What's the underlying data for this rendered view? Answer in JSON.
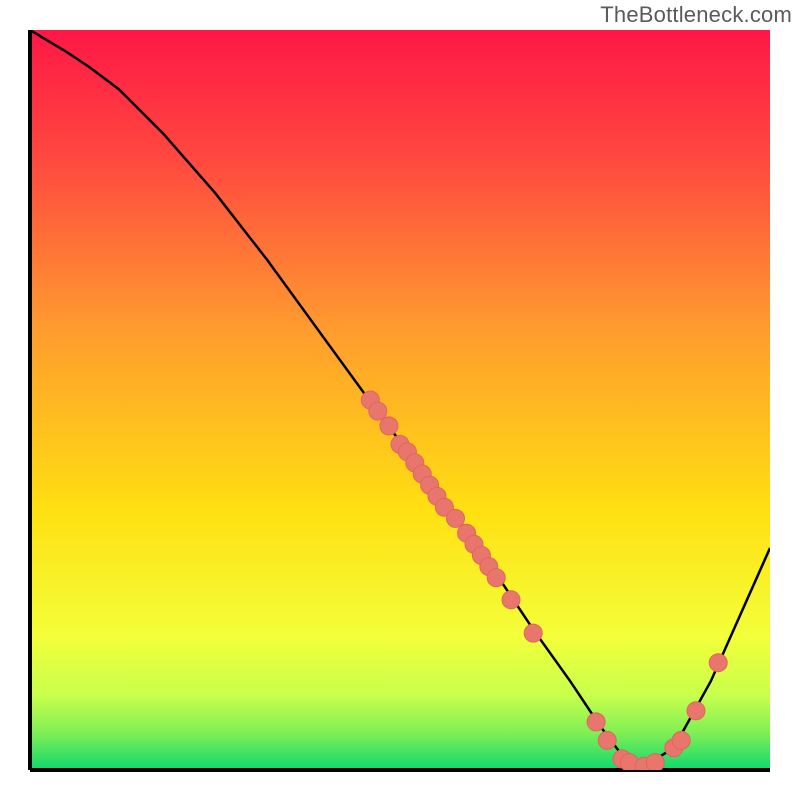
{
  "watermark": "TheBottleneck.com",
  "colors": {
    "gradient_top": "#ff1746",
    "gradient_mid": "#ffe011",
    "gradient_bottom": "#0fd86d",
    "axis": "#000000",
    "curve": "#000000",
    "dot_fill": "#e9766d",
    "dot_stroke": "#e0655c"
  },
  "chart_data": {
    "type": "line",
    "title": "",
    "xlabel": "",
    "ylabel": "",
    "xlim": [
      0,
      100
    ],
    "ylim": [
      0,
      100
    ],
    "curve": {
      "x": [
        0,
        5,
        8,
        12,
        18,
        25,
        32,
        40,
        48,
        55,
        62,
        68,
        73,
        77,
        80,
        83,
        87,
        92,
        100
      ],
      "y": [
        100,
        97,
        95,
        92,
        86,
        78,
        69,
        58,
        47,
        38,
        28,
        19,
        12,
        6,
        2,
        0.5,
        3,
        12,
        30
      ]
    },
    "series": [
      {
        "name": "data-points",
        "points": [
          {
            "x": 46.0,
            "y": 50.0
          },
          {
            "x": 47.0,
            "y": 48.5
          },
          {
            "x": 48.5,
            "y": 46.5
          },
          {
            "x": 50.0,
            "y": 44.0
          },
          {
            "x": 51.0,
            "y": 43.0
          },
          {
            "x": 52.0,
            "y": 41.5
          },
          {
            "x": 53.0,
            "y": 40.0
          },
          {
            "x": 54.0,
            "y": 38.5
          },
          {
            "x": 55.0,
            "y": 37.0
          },
          {
            "x": 56.0,
            "y": 35.5
          },
          {
            "x": 57.5,
            "y": 34.0
          },
          {
            "x": 59.0,
            "y": 32.0
          },
          {
            "x": 60.0,
            "y": 30.5
          },
          {
            "x": 61.0,
            "y": 29.0
          },
          {
            "x": 62.0,
            "y": 27.5
          },
          {
            "x": 63.0,
            "y": 26.0
          },
          {
            "x": 65.0,
            "y": 23.0
          },
          {
            "x": 68.0,
            "y": 18.5
          },
          {
            "x": 76.5,
            "y": 6.5
          },
          {
            "x": 78.0,
            "y": 4.0
          },
          {
            "x": 80.0,
            "y": 1.5
          },
          {
            "x": 81.0,
            "y": 1.0
          },
          {
            "x": 83.0,
            "y": 0.5
          },
          {
            "x": 84.5,
            "y": 1.0
          },
          {
            "x": 87.0,
            "y": 3.0
          },
          {
            "x": 88.0,
            "y": 4.0
          },
          {
            "x": 90.0,
            "y": 8.0
          },
          {
            "x": 93.0,
            "y": 14.5
          }
        ]
      }
    ]
  }
}
